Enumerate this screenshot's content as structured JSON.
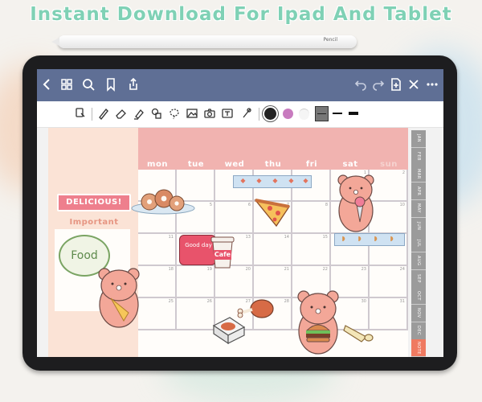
{
  "headline": "Instant Download For Ipad And Tablet",
  "pencil": {
    "brand": "Pencil"
  },
  "navbar": {
    "back_icon": "chevron-left-icon",
    "grid_icon": "grid-icon",
    "search_icon": "search-icon",
    "bookmark_icon": "bookmark-icon",
    "share_icon": "share-icon",
    "undo_icon": "undo-icon",
    "redo_icon": "redo-icon",
    "add_page_icon": "add-page-icon",
    "close_icon": "close-icon",
    "more_icon": "more-icon"
  },
  "toolbar": {
    "tools": [
      "lasso-hand-icon",
      "pen-icon",
      "eraser-icon",
      "highlighter-icon",
      "shapes-icon",
      "lasso-icon",
      "image-icon",
      "camera-icon",
      "text-icon",
      "element-icon"
    ],
    "colors": [
      "#222222",
      "#c87bbf",
      "#e8e8e8",
      "#4a4a4a"
    ]
  },
  "calendar": {
    "days": [
      "mon",
      "tue",
      "wed",
      "thu",
      "fri",
      "sat",
      "sun"
    ],
    "months": [
      "JAN",
      "FEB",
      "MAR",
      "APR",
      "MAY",
      "JUN",
      "JUL",
      "AUG",
      "SEP",
      "OCT",
      "NOV",
      "DEC",
      "NOTE"
    ],
    "active_month": "NOTE",
    "row1_numbers": [
      "",
      "",
      "",
      "",
      "",
      "1",
      "2"
    ],
    "row2_numbers": [
      "4",
      "5",
      "6",
      "7",
      "8",
      "9",
      "10"
    ],
    "row3_numbers": [
      "11",
      "12",
      "13",
      "14",
      "15",
      "16",
      "17"
    ],
    "row4_numbers": [
      "18",
      "19",
      "20",
      "21",
      "22",
      "23",
      "24"
    ],
    "row5_numbers": [
      "25",
      "26",
      "27",
      "28",
      "29",
      "30",
      "31"
    ]
  },
  "left_panel": {
    "delicious_label": "DELICIOUS!",
    "important_label": "Important",
    "food_label": "Food"
  },
  "stickers": {
    "cafe_bubble": "Good day",
    "cafe_cup": "Cafe"
  },
  "colors": {
    "accent_header": "#f1b3b0",
    "nav": "#5f6f95",
    "active_tab": "#ef7a61",
    "headline": "#7fd1b5"
  }
}
